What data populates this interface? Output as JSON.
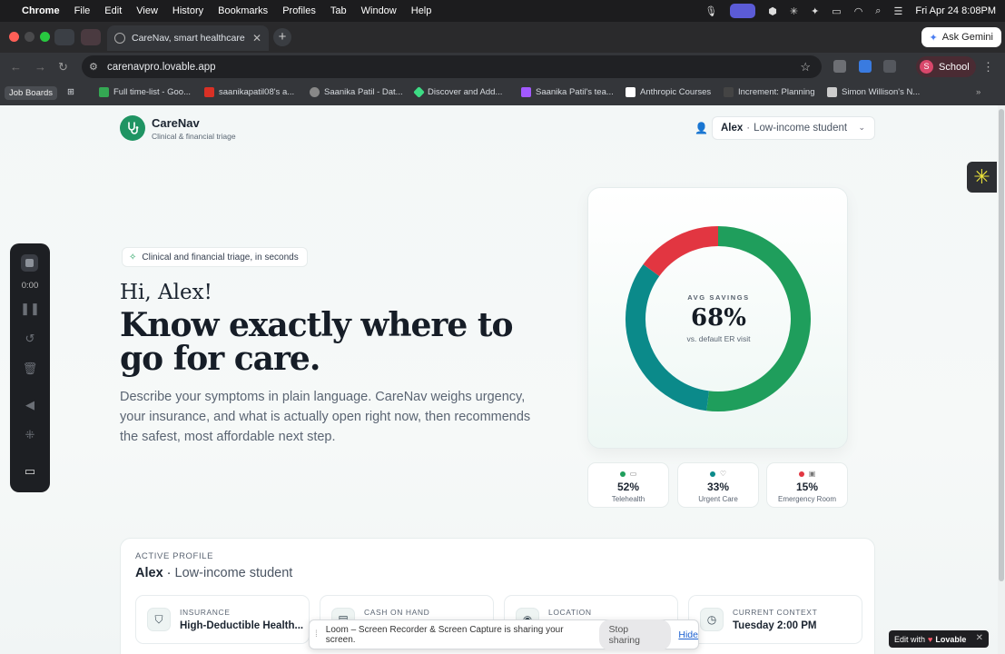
{
  "menubar": {
    "app": "Chrome",
    "items": [
      "File",
      "Edit",
      "View",
      "History",
      "Bookmarks",
      "Profiles",
      "Tab",
      "Window",
      "Help"
    ],
    "datetime": "Fri Apr 24  8:08PM"
  },
  "tabs": {
    "active_title": "CareNav, smart healthcare tri",
    "ask_gemini": "Ask Gemini"
  },
  "omnibox": {
    "url": "carenavpro.lovable.app"
  },
  "profile_chip": {
    "initial": "S",
    "label": "School"
  },
  "bookmarks": {
    "folder": "Job Boards",
    "items": [
      "Full time-list - Goo...",
      "saanikapatil08's a...",
      "Saanika Patil - Dat...",
      "Discover and Add...",
      "Saanika Patil's tea...",
      "Anthropic Courses",
      "Increment: Planning",
      "Simon Willison's N..."
    ],
    "colors": [
      "#34a853",
      "#d93025",
      "#888888",
      "#3ddc84",
      "#a259ff",
      "#ffffff",
      "#444444",
      "#cccccc"
    ]
  },
  "app": {
    "brand": "CareNav",
    "brand_sub": "Clinical & financial triage",
    "persona_name": "Alex",
    "persona_sep": "·",
    "persona_role": "Low-income student",
    "tagline_pill": "Clinical and financial triage, in seconds",
    "greeting": "Hi, Alex!",
    "hero": "Know exactly where to go for care.",
    "description": "Describe your symptoms in plain language. CareNav weighs urgency, your insurance, and what is actually open right now, then recommends the safest, most affordable next step."
  },
  "chart_data": {
    "type": "pie",
    "title": "AVG SAVINGS",
    "center_value": "68%",
    "center_sub": "vs. default ER visit",
    "categories": [
      "Telehealth",
      "Urgent Care",
      "Emergency Room"
    ],
    "values": [
      52,
      33,
      15
    ],
    "value_labels": [
      "52%",
      "33%",
      "15%"
    ],
    "colors": [
      "#1f9e5c",
      "#0b8a8a",
      "#e23641"
    ]
  },
  "active_profile": {
    "label": "ACTIVE PROFILE",
    "name": "Alex",
    "sep": "·",
    "role": "Low-income student",
    "fields": [
      {
        "label": "INSURANCE",
        "value": "High-Deductible Health...",
        "icon": "shield-icon"
      },
      {
        "label": "CASH ON HAND",
        "value": "",
        "icon": "wallet-icon"
      },
      {
        "label": "LOCATION",
        "value": "",
        "icon": "pin-icon"
      },
      {
        "label": "CURRENT CONTEXT",
        "value": "Tuesday 2:00 PM",
        "icon": "clock-icon"
      }
    ]
  },
  "loom": {
    "timer": "0:00",
    "banner": "Loom – Screen Recorder & Screen Capture is sharing your screen.",
    "stop": "Stop sharing",
    "hide": "Hide"
  },
  "lovable": {
    "prefix": "Edit with",
    "brand": "Lovable"
  }
}
